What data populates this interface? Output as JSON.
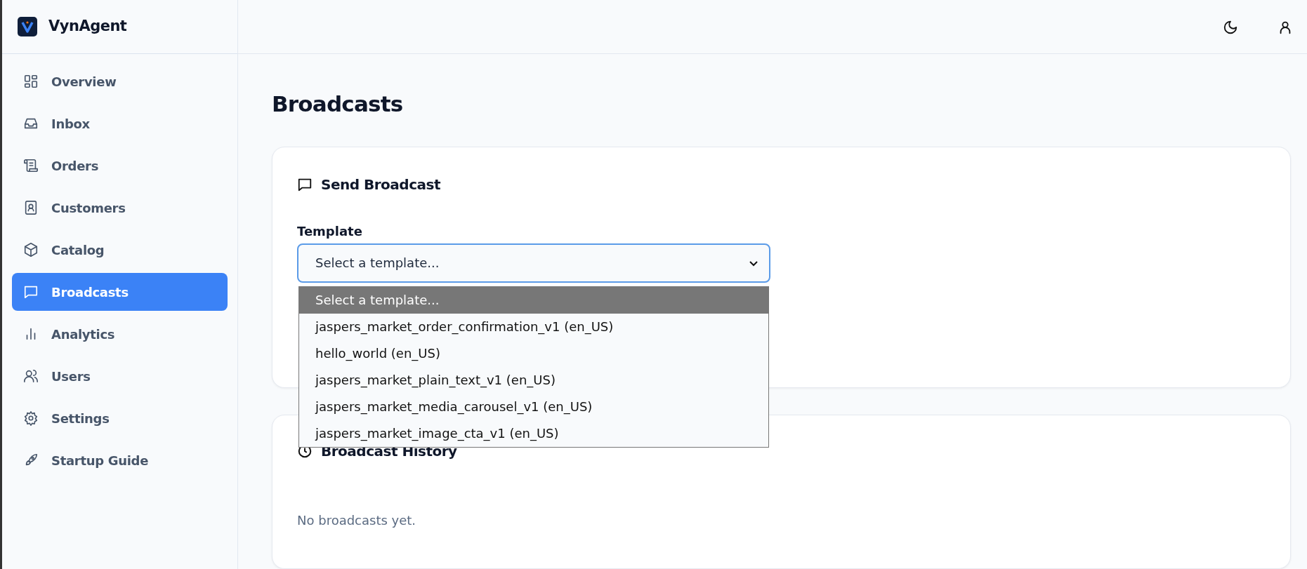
{
  "brand": {
    "name": "VynAgent"
  },
  "sidebar": {
    "items": [
      {
        "label": "Overview",
        "selected": false
      },
      {
        "label": "Inbox",
        "selected": false
      },
      {
        "label": "Orders",
        "selected": false
      },
      {
        "label": "Customers",
        "selected": false
      },
      {
        "label": "Catalog",
        "selected": false
      },
      {
        "label": "Broadcasts",
        "selected": true
      },
      {
        "label": "Analytics",
        "selected": false
      },
      {
        "label": "Users",
        "selected": false
      },
      {
        "label": "Settings",
        "selected": false
      },
      {
        "label": "Startup Guide",
        "selected": false
      }
    ]
  },
  "page": {
    "title": "Broadcasts"
  },
  "send_card": {
    "title": "Send Broadcast",
    "field_label": "Template",
    "value": "Select a template...",
    "expanded": true,
    "options": [
      {
        "label": "Select a template...",
        "selected": true
      },
      {
        "label": "jaspers_market_order_confirmation_v1 (en_US)",
        "selected": false
      },
      {
        "label": "hello_world (en_US)",
        "selected": false
      },
      {
        "label": "jaspers_market_plain_text_v1 (en_US)",
        "selected": false
      },
      {
        "label": "jaspers_market_media_carousel_v1 (en_US)",
        "selected": false
      },
      {
        "label": "jaspers_market_image_cta_v1 (en_US)",
        "selected": false
      }
    ]
  },
  "history_card": {
    "title": "Broadcast History",
    "empty_text": "No broadcasts yet."
  }
}
